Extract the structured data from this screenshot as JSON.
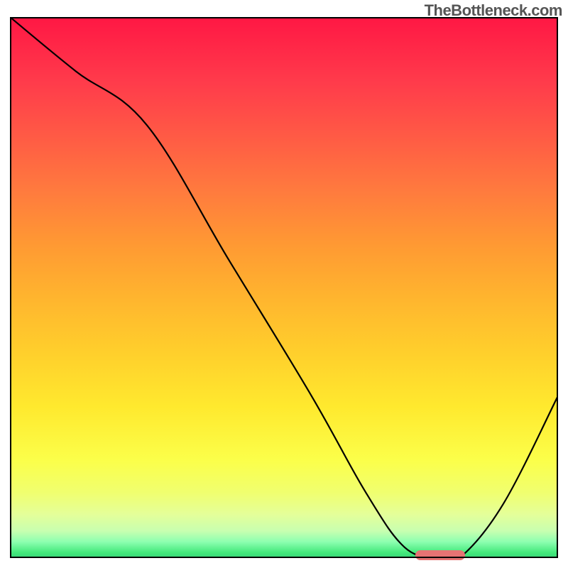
{
  "watermark": "TheBottleneck.com",
  "chart_data": {
    "type": "line",
    "title": "",
    "xlabel": "",
    "ylabel": "",
    "xlim": [
      0,
      100
    ],
    "ylim": [
      0,
      100
    ],
    "grid": false,
    "background_gradient": {
      "top_color": "#ff1744",
      "mid_color": "#ffeb3b",
      "bottom_color": "#38d278"
    },
    "series": [
      {
        "name": "bottleneck-curve",
        "x": [
          0,
          12,
          25,
          40,
          55,
          65,
          72,
          78,
          82,
          90,
          100
        ],
        "values": [
          100,
          90,
          80,
          55,
          30,
          12,
          2,
          0,
          0,
          10,
          30
        ]
      }
    ],
    "marker": {
      "name": "optimal-range",
      "x_start": 74,
      "x_end": 83,
      "y": 0,
      "color": "#e57373"
    }
  }
}
